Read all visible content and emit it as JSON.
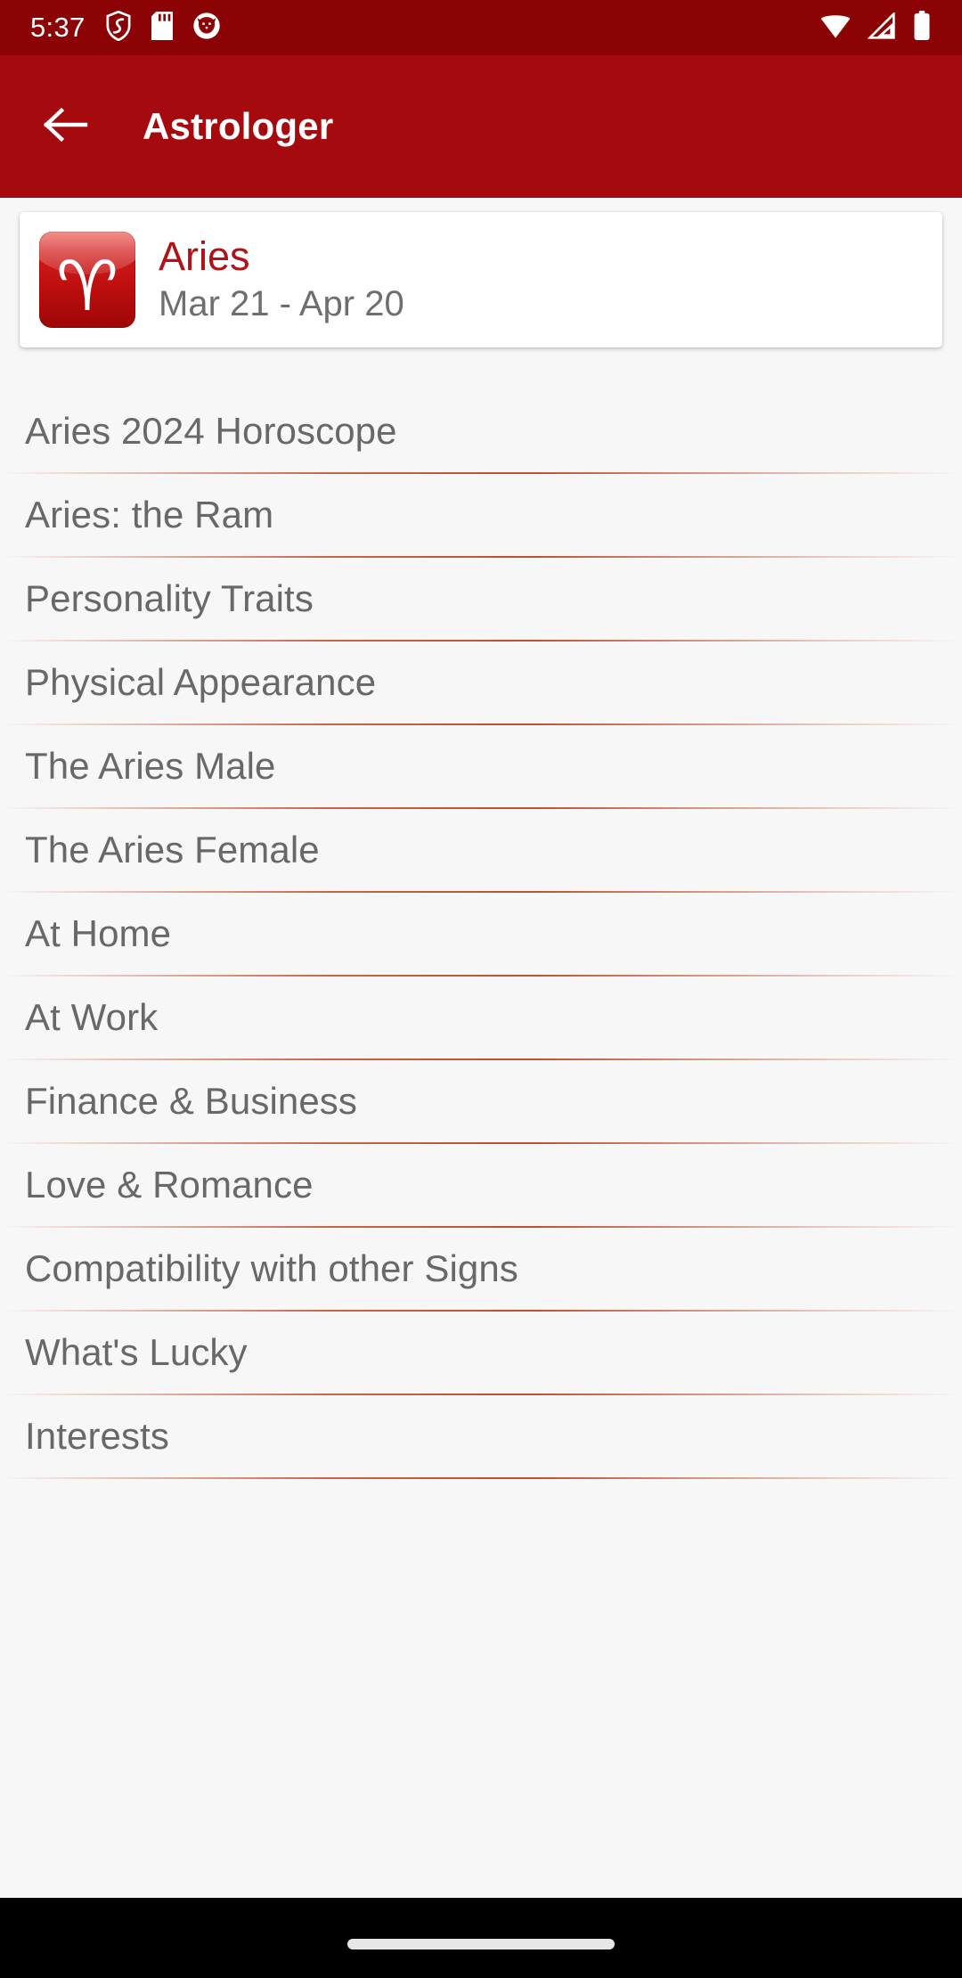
{
  "status_bar": {
    "time": "5:37",
    "background_color": "#8b0304",
    "left_icons": [
      {
        "name": "shield-icon",
        "label": "VPN / security shield"
      },
      {
        "name": "sd-card-icon",
        "label": "SD card"
      },
      {
        "name": "app-notification-icon",
        "label": "App notification"
      }
    ],
    "right_icons": [
      {
        "name": "wifi-icon",
        "label": "Wi-Fi full signal"
      },
      {
        "name": "cellular-signal-icon",
        "label": "Mobile signal"
      },
      {
        "name": "battery-icon",
        "label": "Battery full"
      }
    ]
  },
  "app_bar": {
    "title": "Astrologer",
    "back_icon": "arrow-left-icon",
    "background_color": "#a50a0e",
    "title_color": "#ffffff"
  },
  "sign_card": {
    "glyph": "♈",
    "name": "Aries",
    "dates": "Mar 21 - Apr 20",
    "name_color": "#b01217",
    "dates_color": "#6e6e6e",
    "badge_color": "#c11818"
  },
  "list": {
    "text_color": "#686868",
    "divider_color": "#be4c28",
    "items": [
      {
        "label": "Aries 2024 Horoscope"
      },
      {
        "label": "Aries: the Ram"
      },
      {
        "label": "Personality Traits"
      },
      {
        "label": "Physical Appearance"
      },
      {
        "label": "The Aries Male"
      },
      {
        "label": "The Aries Female"
      },
      {
        "label": "At Home"
      },
      {
        "label": "At Work"
      },
      {
        "label": "Finance & Business"
      },
      {
        "label": "Love & Romance"
      },
      {
        "label": "Compatibility with other Signs"
      },
      {
        "label": "What's Lucky"
      },
      {
        "label": "Interests"
      }
    ]
  },
  "nav_bar": {
    "gesture_pill": "home-gesture-pill",
    "background_color": "#000000"
  }
}
